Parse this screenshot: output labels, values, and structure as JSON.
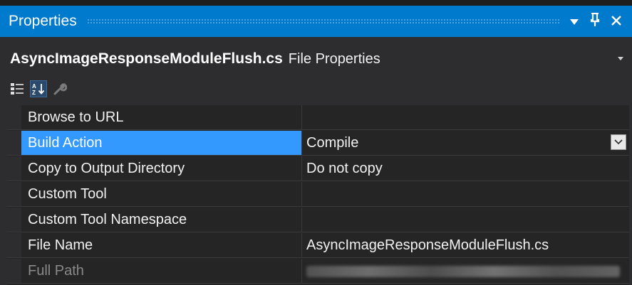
{
  "window": {
    "title": "Properties"
  },
  "object": {
    "name": "AsyncImageResponseModuleFlush.cs",
    "type": "File Properties"
  },
  "toolbar": {
    "categorized_icon": "categorized-icon",
    "alphabetical_icon": "alphabetical-icon",
    "property_pages_icon": "wrench-icon"
  },
  "properties": [
    {
      "name": "Browse to URL",
      "value": ""
    },
    {
      "name": "Build Action",
      "value": "Compile"
    },
    {
      "name": "Copy to Output Directory",
      "value": "Do not copy"
    },
    {
      "name": "Custom Tool",
      "value": ""
    },
    {
      "name": "Custom Tool Namespace",
      "value": ""
    },
    {
      "name": "File Name",
      "value": "AsyncImageResponseModuleFlush.cs"
    },
    {
      "name": "Full Path",
      "value": ""
    }
  ],
  "colors": {
    "accent": "#007acc",
    "selection": "#3399ff",
    "background": "#2d2d30"
  }
}
